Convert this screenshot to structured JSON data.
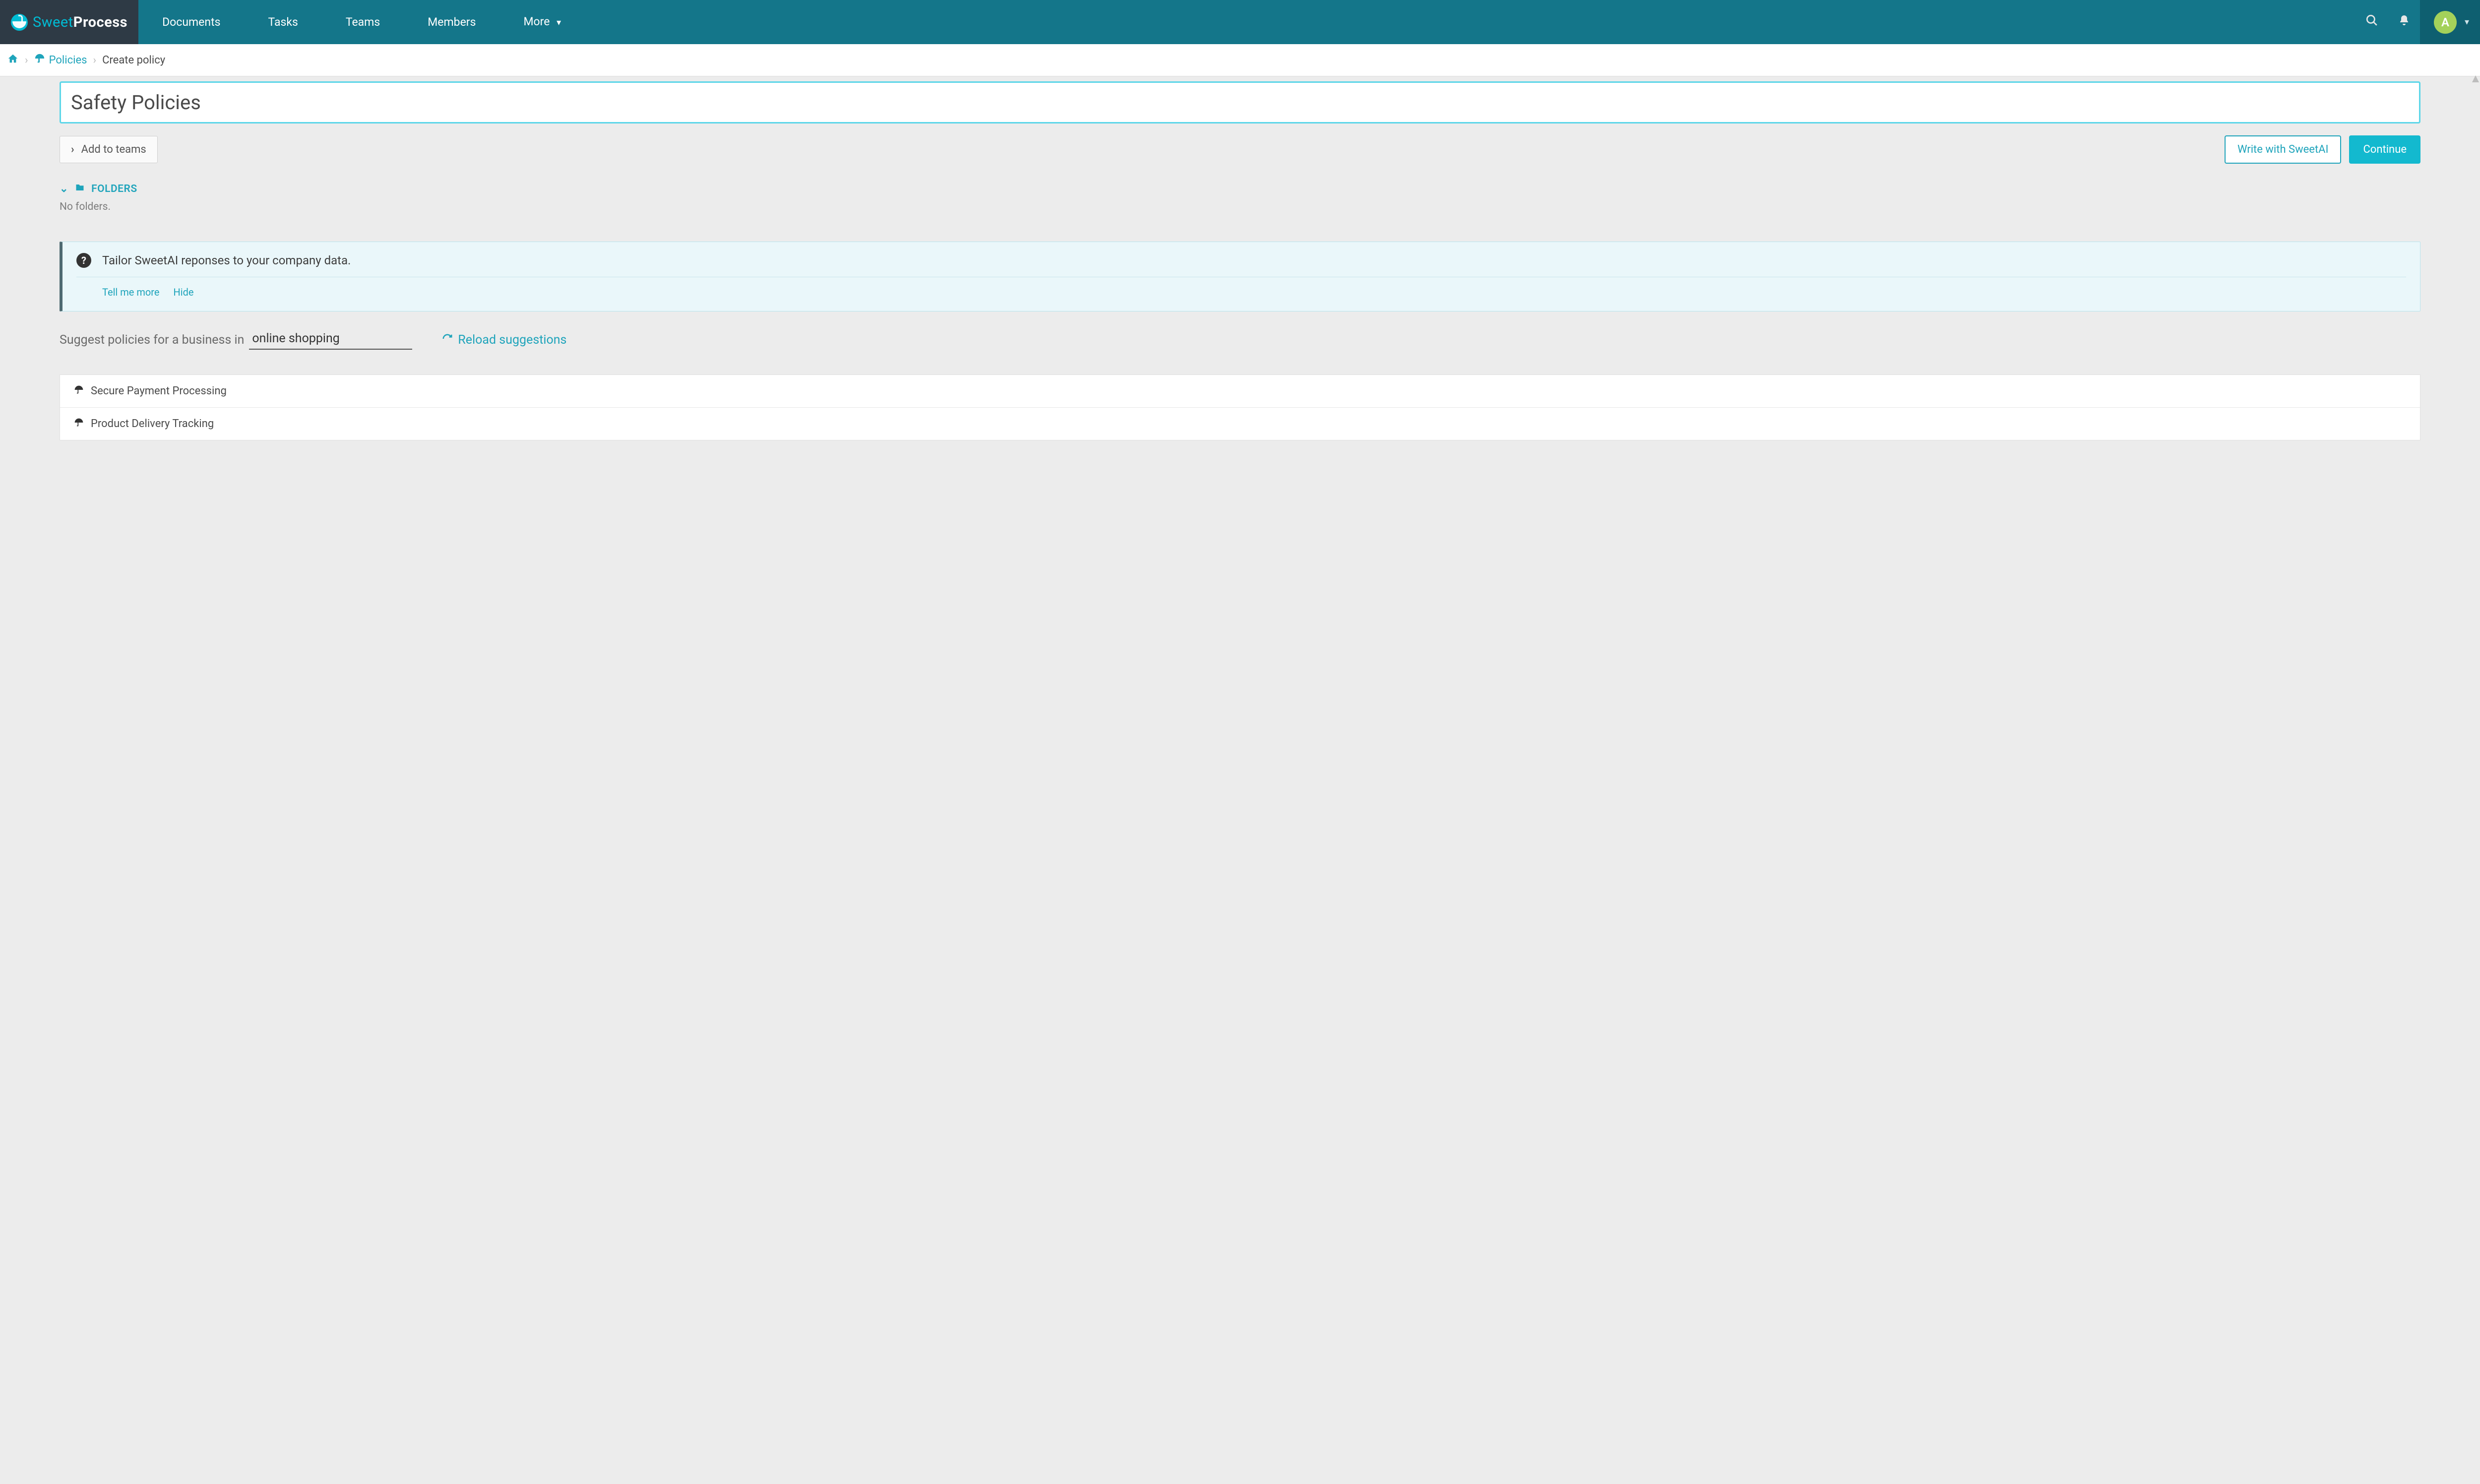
{
  "brand": {
    "light": "Sweet",
    "bold": "Process"
  },
  "nav": {
    "items": [
      "Documents",
      "Tasks",
      "Teams",
      "Members"
    ],
    "more": "More"
  },
  "user": {
    "initial": "A"
  },
  "breadcrumb": {
    "policies": "Policies",
    "current": "Create policy"
  },
  "form": {
    "title_value": "Safety Policies",
    "add_to_teams": "Add to teams",
    "write_ai": "Write with SweetAI",
    "continue": "Continue"
  },
  "folders": {
    "label": "FOLDERS",
    "empty": "No folders."
  },
  "info": {
    "message": "Tailor SweetAI reponses to your company data.",
    "tell_more": "Tell me more",
    "hide": "Hide"
  },
  "suggest": {
    "prefix": "Suggest policies for a business in",
    "business_value": "online shopping",
    "reload": "Reload suggestions"
  },
  "suggestions": [
    "Secure Payment Processing",
    "Product Delivery Tracking"
  ]
}
